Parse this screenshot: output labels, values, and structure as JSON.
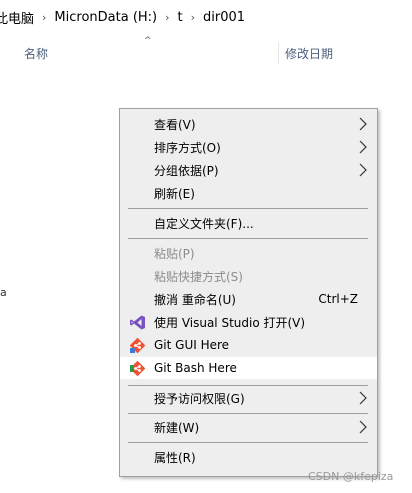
{
  "breadcrumb": {
    "items": [
      "此电脑",
      "MicronData (H:)",
      "t",
      "dir001"
    ],
    "separator": "›"
  },
  "list_header": {
    "sort_arrow": "^",
    "name_column": "名称",
    "date_column": "修改日期"
  },
  "left_edge_glyph": "a",
  "context_menu": {
    "items": [
      {
        "label": "查看(V)",
        "submenu": true
      },
      {
        "label": "排序方式(O)",
        "submenu": true
      },
      {
        "label": "分组依据(P)",
        "submenu": true
      },
      {
        "label": "刷新(E)"
      },
      {
        "label": "自定义文件夹(F)..."
      },
      {
        "label": "粘贴(P)",
        "disabled": true
      },
      {
        "label": "粘贴快捷方式(S)",
        "disabled": true
      },
      {
        "label": "撤消 重命名(U)",
        "shortcut": "Ctrl+Z"
      },
      {
        "label": "使用 Visual Studio 打开(V)",
        "icon": "visual-studio-icon"
      },
      {
        "label": "Git GUI Here",
        "icon": "git-gui-icon"
      },
      {
        "label": "Git Bash Here",
        "icon": "git-bash-icon",
        "highlighted": true
      },
      {
        "label": "授予访问权限(G)",
        "submenu": true
      },
      {
        "label": "新建(W)",
        "submenu": true
      },
      {
        "label": "属性(R)"
      }
    ]
  },
  "watermark": "CSDN @kfepiza",
  "colors": {
    "menu_bg": "#eeeeee",
    "highlight_bg": "#ffffff",
    "disabled_text": "#8c8c8c",
    "header_text": "#4c607a",
    "vs_purple": "#7b52c0",
    "git_orange": "#f05033"
  }
}
